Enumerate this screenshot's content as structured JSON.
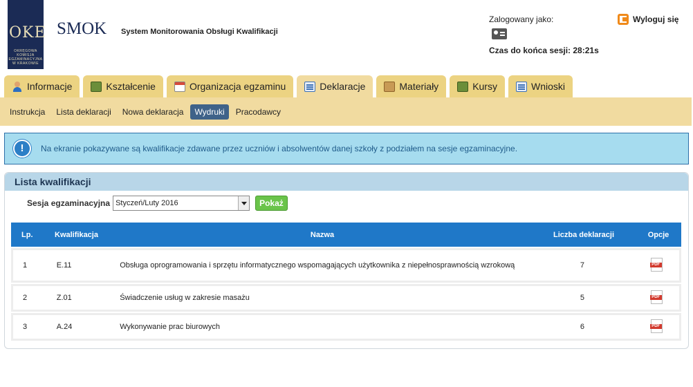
{
  "header": {
    "logo_letters": "OKE",
    "logo_sub": "OKRĘGOWA KOMISJA EGZAMINACYJNA W KRAKOWIE",
    "app_name": "SMOK",
    "app_desc": "System Monitorowania Obsługi Kwalifikacji",
    "logged_label": "Zalogowany jako:",
    "session_time": "Czas do końca sesji: 28:21s",
    "logout_label": "Wyloguj się"
  },
  "tabs": [
    {
      "label": "Informacje",
      "icon": "person-icon"
    },
    {
      "label": "Kształcenie",
      "icon": "board-icon"
    },
    {
      "label": "Organizacja egzaminu",
      "icon": "calendar-icon"
    },
    {
      "label": "Deklaracje",
      "icon": "document-icon"
    },
    {
      "label": "Materiały",
      "icon": "box-icon"
    },
    {
      "label": "Kursy",
      "icon": "board-icon"
    },
    {
      "label": "Wnioski",
      "icon": "document-icon"
    }
  ],
  "subnav": [
    "Instrukcja",
    "Lista deklaracji",
    "Nowa deklaracja",
    "Wydruki",
    "Pracodawcy"
  ],
  "alert": {
    "text": "Na ekranie pokazywane są kwalifikacje zdawane przez uczniów i absolwentów danej szkoły z podziałem na sesje egzaminacyjne."
  },
  "panel": {
    "title": "Lista kwalifikacji",
    "session_label": "Sesja egzaminacyjna",
    "session_value": "Styczeń/Luty 2016",
    "show_label": "Pokaż"
  },
  "table": {
    "headers": {
      "lp": "Lp.",
      "kw": "Kwalifikacja",
      "nz": "Nazwa",
      "ld": "Liczba deklaracji",
      "op": "Opcje"
    },
    "rows": [
      {
        "lp": "1",
        "kw": "E.11",
        "nz": "Obsługa oprogramowania i sprzętu informatycznego wspomagających użytkownika z niepełnosprawnością wzrokową",
        "ld": "7"
      },
      {
        "lp": "2",
        "kw": "Z.01",
        "nz": "Świadczenie usług w zakresie masażu",
        "ld": "5"
      },
      {
        "lp": "3",
        "kw": "A.24",
        "nz": "Wykonywanie prac biurowych",
        "ld": "6"
      }
    ]
  },
  "colors": {
    "accent": "#1f78c8",
    "tab": "#ecd382",
    "subnav_active": "#3f6289",
    "alert_bg": "#a6dcef",
    "show_button": "#6ac44a"
  }
}
